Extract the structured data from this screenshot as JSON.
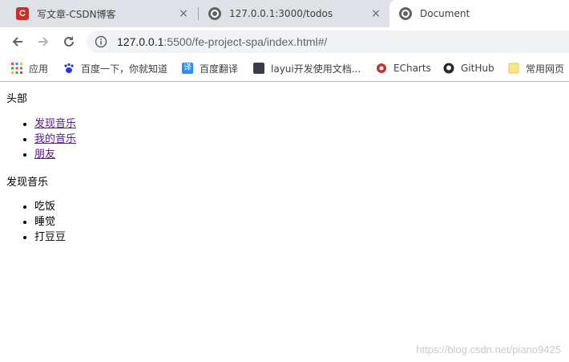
{
  "browser": {
    "tabs": [
      {
        "title": "写文章-CSDN博客",
        "icon": "csdn-icon",
        "close": "×",
        "active": false
      },
      {
        "title": "127.0.0.1:3000/todos",
        "icon": "globe-icon",
        "close": "×",
        "active": false
      },
      {
        "title": "Document",
        "icon": "globe-icon",
        "close": "×",
        "active": true
      }
    ],
    "address": {
      "host": "127.0.0.1",
      "rest": ":5500/fe-project-spa/index.html#/"
    },
    "bookmarks": [
      {
        "label": "应用",
        "icon": "apps-grid-icon"
      },
      {
        "label": "百度一下，你就知道",
        "icon": "baidu-paw-icon"
      },
      {
        "label": "百度翻译",
        "icon": "translate-icon"
      },
      {
        "label": "layui开发使用文档...",
        "icon": "layui-icon"
      },
      {
        "label": "ECharts",
        "icon": "echarts-icon"
      },
      {
        "label": "GitHub",
        "icon": "github-icon"
      },
      {
        "label": "常用网页",
        "icon": "folder-icon"
      }
    ]
  },
  "page": {
    "header": "头部",
    "nav": [
      "发现音乐",
      "我的音乐",
      "朋友"
    ],
    "section_title": "发现音乐",
    "items": [
      "吃饭",
      "睡觉",
      "打豆豆"
    ],
    "watermark": "https://blog.csdn.net/piano9425"
  },
  "colors": {
    "tabstrip": "#dee1e6",
    "link": "#551a8b",
    "omnibox": "#f1f3f4"
  }
}
